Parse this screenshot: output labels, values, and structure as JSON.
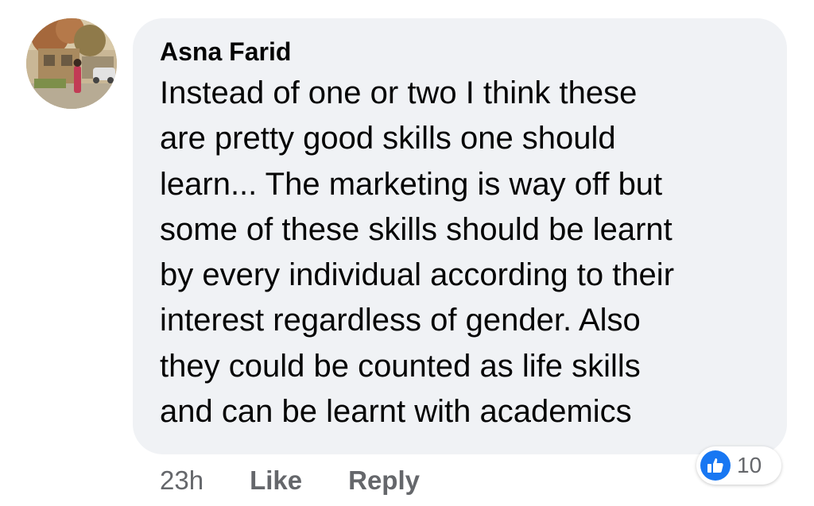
{
  "comment": {
    "author": "Asna Farid",
    "text_lines": [
      "Instead of one or two I think these",
      "are pretty good skills one should",
      "learn... The marketing is way off but",
      "some of these skills should be learnt",
      "by every individual according to their",
      "interest regardless of gender. Also",
      "they could be counted as life skills",
      "and can be learnt with academics"
    ]
  },
  "actions": {
    "time": "23h",
    "like_label": "Like",
    "reply_label": "Reply"
  },
  "reactions": {
    "icon": "thumbs-up-icon",
    "count": "10",
    "accent_color": "#1877f2"
  },
  "colors": {
    "bubble_bg": "#f0f2f5",
    "meta_text": "#65676b",
    "body_text": "#050505"
  }
}
